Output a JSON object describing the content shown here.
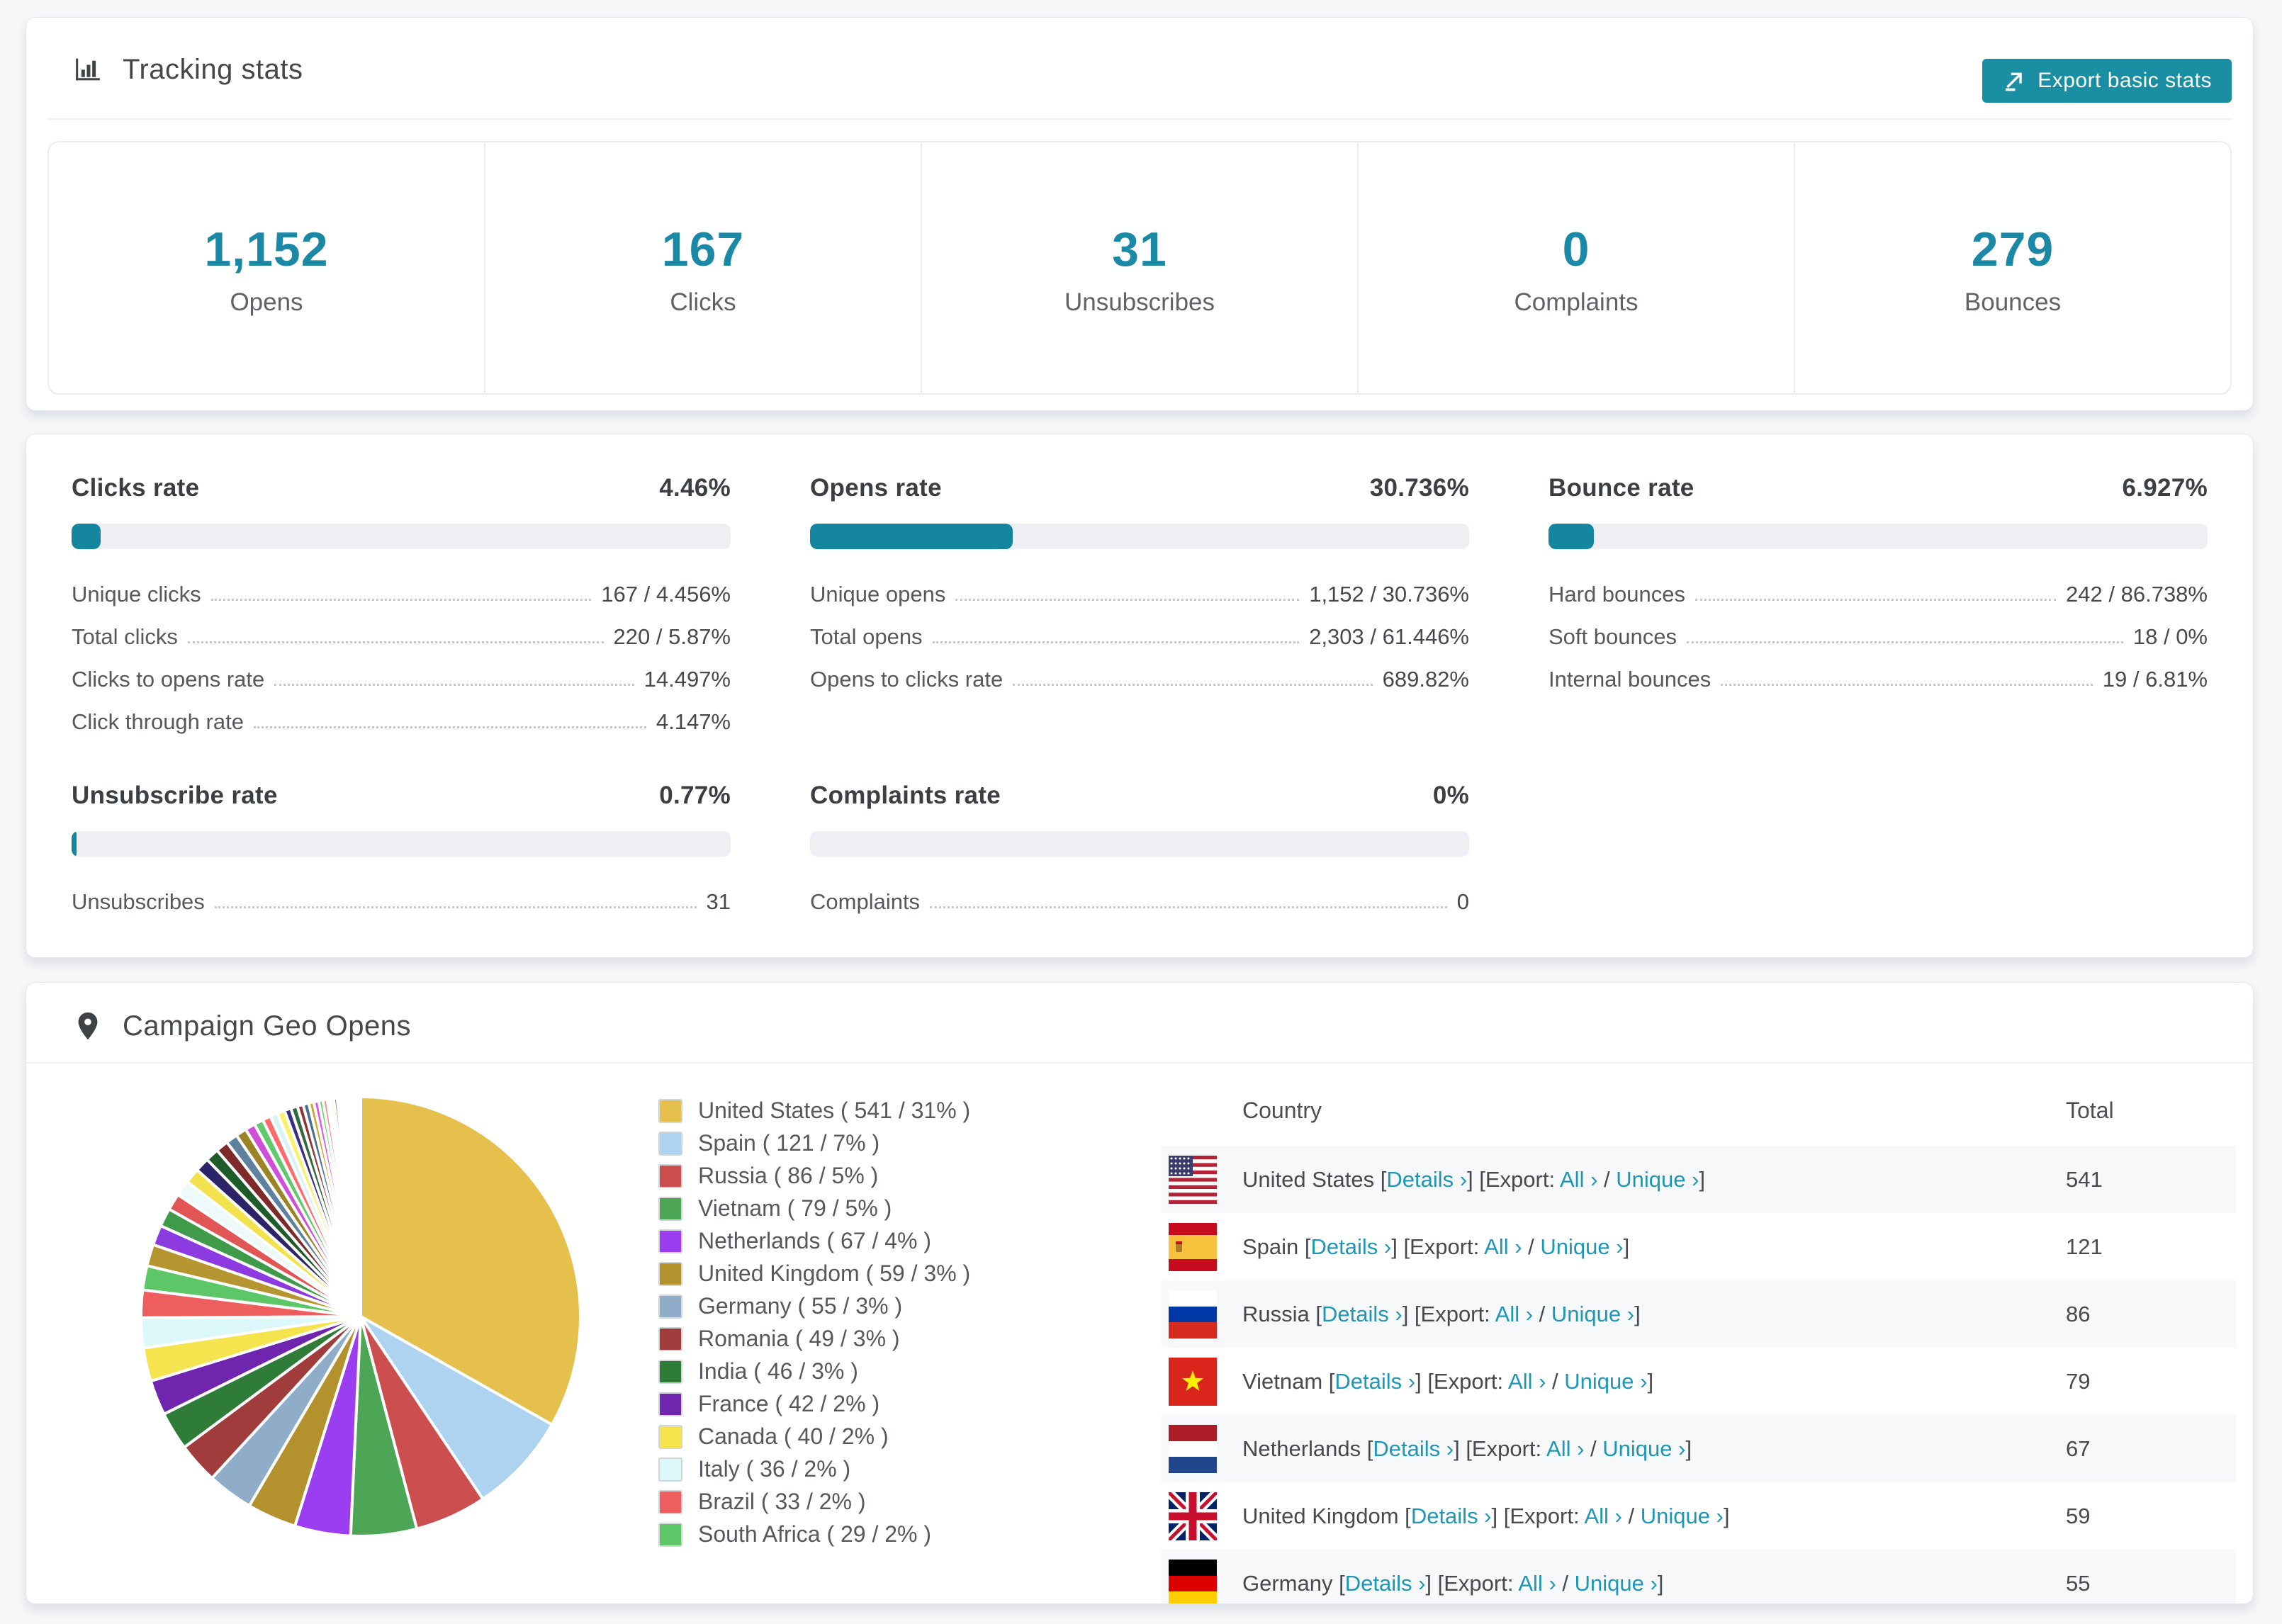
{
  "header": {
    "title": "Tracking stats",
    "export_button": "Export basic stats"
  },
  "stats": {
    "items": [
      {
        "value": "1,152",
        "label": "Opens"
      },
      {
        "value": "167",
        "label": "Clicks"
      },
      {
        "value": "31",
        "label": "Unsubscribes"
      },
      {
        "value": "0",
        "label": "Complaints"
      },
      {
        "value": "279",
        "label": "Bounces"
      }
    ]
  },
  "rates": {
    "clicks": {
      "title": "Clicks rate",
      "value": "4.46%",
      "bar_pct": 4.46,
      "rows": [
        {
          "label": "Unique clicks",
          "value": "167 / 4.456%"
        },
        {
          "label": "Total clicks",
          "value": "220 / 5.87%"
        },
        {
          "label": "Clicks to opens rate",
          "value": "14.497%"
        },
        {
          "label": "Click through rate",
          "value": "4.147%"
        }
      ]
    },
    "opens": {
      "title": "Opens rate",
      "value": "30.736%",
      "bar_pct": 30.736,
      "rows": [
        {
          "label": "Unique opens",
          "value": "1,152 / 30.736%"
        },
        {
          "label": "Total opens",
          "value": "2,303 / 61.446%"
        },
        {
          "label": "Opens to clicks rate",
          "value": "689.82%"
        }
      ]
    },
    "bounce": {
      "title": "Bounce rate",
      "value": "6.927%",
      "bar_pct": 6.927,
      "rows": [
        {
          "label": "Hard bounces",
          "value": "242 / 86.738%"
        },
        {
          "label": "Soft bounces",
          "value": "18 / 0%"
        },
        {
          "label": "Internal bounces",
          "value": "19 / 6.81%"
        }
      ]
    },
    "unsubscribe": {
      "title": "Unsubscribe rate",
      "value": "0.77%",
      "bar_pct": 0.77,
      "rows": [
        {
          "label": "Unsubscribes",
          "value": "31"
        }
      ]
    },
    "complaints": {
      "title": "Complaints rate",
      "value": "0%",
      "bar_pct": 0,
      "rows": [
        {
          "label": "Complaints",
          "value": "0"
        }
      ]
    }
  },
  "geo": {
    "title": "Campaign Geo Opens",
    "legend": [
      {
        "label": "United States ( 541 / 31% )",
        "color": "#e5c04c"
      },
      {
        "label": "Spain ( 121 / 7% )",
        "color": "#aed3f0"
      },
      {
        "label": "Russia ( 86 / 5% )",
        "color": "#cc4e4e"
      },
      {
        "label": "Vietnam ( 79 / 5% )",
        "color": "#4ca655"
      },
      {
        "label": "Netherlands ( 67 / 4% )",
        "color": "#9b3df0"
      },
      {
        "label": "United Kingdom ( 59 / 3% )",
        "color": "#b3912d"
      },
      {
        "label": "Germany ( 55 / 3% )",
        "color": "#8fadc8"
      },
      {
        "label": "Romania ( 49 / 3% )",
        "color": "#a03c3c"
      },
      {
        "label": "India ( 46 / 3% )",
        "color": "#2f7c38"
      },
      {
        "label": "France ( 42 / 2% )",
        "color": "#6f25ae"
      },
      {
        "label": "Canada ( 40 / 2% )",
        "color": "#f6e44e"
      },
      {
        "label": "Italy ( 36 / 2% )",
        "color": "#dcf8fb"
      },
      {
        "label": "Brazil ( 33 / 2% )",
        "color": "#ef5e5e"
      },
      {
        "label": "South Africa ( 29 / 2% )",
        "color": "#5dc767"
      }
    ],
    "table": {
      "headers": [
        "Country",
        "Total"
      ],
      "bracket_open": "[",
      "bracket_close": "]",
      "link_details": "Details",
      "export_label": "Export:",
      "link_all": "All",
      "link_unique": "Unique",
      "chevron": "›",
      "slash": "/",
      "rows": [
        {
          "country": "United States",
          "flag": "us",
          "total": "541"
        },
        {
          "country": "Spain",
          "flag": "es",
          "total": "121"
        },
        {
          "country": "Russia",
          "flag": "ru",
          "total": "86"
        },
        {
          "country": "Vietnam",
          "flag": "vn",
          "total": "79"
        },
        {
          "country": "Netherlands",
          "flag": "nl",
          "total": "67"
        },
        {
          "country": "United Kingdom",
          "flag": "gb",
          "total": "59"
        },
        {
          "country": "Germany",
          "flag": "de",
          "total": "55"
        }
      ]
    }
  },
  "chart_data": {
    "type": "pie",
    "title": "Campaign Geo Opens",
    "unit": "opens",
    "start_angle_deg": -90,
    "direction": "clockwise",
    "legend_position": "right",
    "slices": [
      {
        "label": "United States",
        "value": 541,
        "pct": 31,
        "color": "#e5c04c"
      },
      {
        "label": "Spain",
        "value": 121,
        "pct": 7,
        "color": "#aed3f0"
      },
      {
        "label": "Russia",
        "value": 86,
        "pct": 5,
        "color": "#cc4e4e"
      },
      {
        "label": "Vietnam",
        "value": 79,
        "pct": 5,
        "color": "#4ca655"
      },
      {
        "label": "Netherlands",
        "value": 67,
        "pct": 4,
        "color": "#9b3df0"
      },
      {
        "label": "United Kingdom",
        "value": 59,
        "pct": 3,
        "color": "#b3912d"
      },
      {
        "label": "Germany",
        "value": 55,
        "pct": 3,
        "color": "#8fadc8"
      },
      {
        "label": "Romania",
        "value": 49,
        "pct": 3,
        "color": "#a03c3c"
      },
      {
        "label": "India",
        "value": 46,
        "pct": 3,
        "color": "#2f7c38"
      },
      {
        "label": "France",
        "value": 42,
        "pct": 2,
        "color": "#6f25ae"
      },
      {
        "label": "Canada",
        "value": 40,
        "pct": 2,
        "color": "#f6e44e"
      },
      {
        "label": "Italy",
        "value": 36,
        "pct": 2,
        "color": "#dcf8fb"
      },
      {
        "label": "Brazil",
        "value": 33,
        "pct": 2,
        "color": "#ef5e5e"
      },
      {
        "label": "South Africa",
        "value": 29,
        "pct": 2,
        "color": "#5dc767"
      }
    ],
    "other_slices": [
      {
        "value": 26,
        "color": "#b5952f"
      },
      {
        "value": 24,
        "color": "#8b3be0"
      },
      {
        "value": 22,
        "color": "#3f9b4a"
      },
      {
        "value": 20,
        "color": "#e25555"
      },
      {
        "value": 19,
        "color": "#eef9f9"
      },
      {
        "value": 18,
        "color": "#f2e24e"
      },
      {
        "value": 17,
        "color": "#2c2468"
      },
      {
        "value": 16,
        "color": "#1d5c2a"
      },
      {
        "value": 15,
        "color": "#7e2a2a"
      },
      {
        "value": 14,
        "color": "#5e81a0"
      },
      {
        "value": 13,
        "color": "#9a8428"
      },
      {
        "value": 12,
        "color": "#cf4fd9"
      },
      {
        "value": 11,
        "color": "#63c96e"
      },
      {
        "value": 10,
        "color": "#ff6b6b"
      },
      {
        "value": 9,
        "color": "#d9f2f4"
      },
      {
        "value": 9,
        "color": "#fbf06a"
      },
      {
        "value": 8,
        "color": "#3a2f86"
      },
      {
        "value": 8,
        "color": "#2f6b3f"
      },
      {
        "value": 7,
        "color": "#8f3434"
      },
      {
        "value": 7,
        "color": "#49708f"
      },
      {
        "value": 6,
        "color": "#c9a52f"
      },
      {
        "value": 6,
        "color": "#e055e0"
      },
      {
        "value": 5,
        "color": "#55d96b"
      },
      {
        "value": 5,
        "color": "#ff8080"
      },
      {
        "value": 4,
        "color": "#e4f6f8"
      },
      {
        "value": 4,
        "color": "#fff27a"
      },
      {
        "value": 4,
        "color": "#4a3f9f"
      },
      {
        "value": 3,
        "color": "#3f7b4f"
      },
      {
        "value": 3,
        "color": "#a04040"
      },
      {
        "value": 3,
        "color": "#5a86a8"
      },
      {
        "value": 3,
        "color": "#d9b53f"
      },
      {
        "value": 2,
        "color": "#ef66ef"
      },
      {
        "value": 2,
        "color": "#66e07b"
      },
      {
        "value": 2,
        "color": "#ff9898"
      },
      {
        "value": 2,
        "color": "#eefafc"
      },
      {
        "value": 2,
        "color": "#fff59a"
      },
      {
        "value": 1,
        "color": "#5a50b5"
      },
      {
        "value": 1,
        "color": "#4f8b5f"
      },
      {
        "value": 1,
        "color": "#b05050"
      },
      {
        "value": 1,
        "color": "#6b97bf"
      },
      {
        "value": 1,
        "color": "#d4b02f"
      },
      {
        "value": 1,
        "color": "#9b40ee"
      }
    ]
  }
}
